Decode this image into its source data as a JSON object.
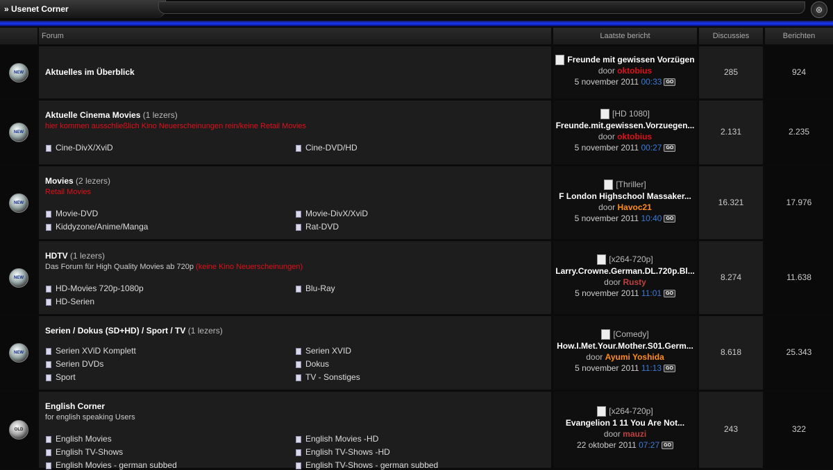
{
  "topbar": {
    "title": "» Usenet Corner",
    "collapse_symbol": "⊜"
  },
  "header": {
    "forum": "Forum",
    "last_post": "Laatste bericht",
    "discussions": "Discussies",
    "messages": "Berichten"
  },
  "colors": {
    "accent_blue": "#1438ff",
    "red": "#e0101a",
    "orange": "#ff8c1a",
    "brown": "#c04040",
    "time_blue": "#3b7bd8"
  },
  "forums": [
    {
      "badge": "NEW",
      "title": "Aktuelles im Überblick",
      "readers": "",
      "description": "",
      "description_extra": "",
      "subforums_left": [],
      "subforums_right": [],
      "last_post": {
        "prefix": "",
        "thread": "Freunde mit gewissen Vorzügen",
        "by": "door",
        "user": "oktobius",
        "user_color": "#e0101a",
        "date": "5 november 2011",
        "time": "00:33"
      },
      "discussions": "285",
      "messages": "924"
    },
    {
      "badge": "NEW",
      "title": "Aktuelle Cinema Movies",
      "readers": "(1 lezers)",
      "description": "hier kommen ausschließlich Kino Neuerscheinungen rein/keine Retail Movies",
      "description_red": true,
      "description_extra": "",
      "subforums_left": [
        "Cine-DivX/XviD"
      ],
      "subforums_right": [
        "Cine-DVD/HD"
      ],
      "last_post": {
        "prefix": "[HD 1080]",
        "thread": "Freunde.mit.gewissen.Vorzuegen...",
        "by": "door",
        "user": "oktobius",
        "user_color": "#e0101a",
        "date": "5 november 2011",
        "time": "00:27"
      },
      "discussions": "2.131",
      "messages": "2.235"
    },
    {
      "badge": "NEW",
      "title": "Movies",
      "readers": "(2 lezers)",
      "description": "Retail Movies",
      "description_red": true,
      "description_extra": "",
      "subforums_left": [
        "Movie-DVD",
        "Kiddyzone/Anime/Manga"
      ],
      "subforums_right": [
        "Movie-DivX/XviD",
        "Rat-DVD"
      ],
      "last_post": {
        "prefix": "[Thriller]",
        "thread": "F London Highschool Massaker...",
        "by": "door",
        "user": "Havoc21",
        "user_color": "#ff8c1a",
        "date": "5 november 2011",
        "time": "10:40"
      },
      "discussions": "16.321",
      "messages": "17.976"
    },
    {
      "badge": "NEW",
      "title": "HDTV",
      "readers": "(1 lezers)",
      "description": "Das Forum für High Quality Movies ab 720p",
      "description_red": false,
      "description_extra": "(keine Kino Neuerscheinungen)",
      "subforums_left": [
        "HD-Movies 720p-1080p",
        "HD-Serien"
      ],
      "subforums_right": [
        "Blu-Ray"
      ],
      "last_post": {
        "prefix": "[x264-720p]",
        "thread": "Larry.Crowne.German.DL.720p.Bl...",
        "by": "door",
        "user": "Rusty",
        "user_color": "#c04040",
        "date": "5 november 2011",
        "time": "11:01"
      },
      "discussions": "8.274",
      "messages": "11.638"
    },
    {
      "badge": "NEW",
      "title": "Serien / Dokus (SD+HD) / Sport / TV",
      "readers": "(1 lezers)",
      "description": "",
      "description_red": false,
      "description_extra": "",
      "subforums_left": [
        "Serien XViD Komplett",
        "Serien DVDs",
        "Sport"
      ],
      "subforums_right": [
        "Serien XVID",
        "Dokus",
        "TV - Sonstiges"
      ],
      "last_post": {
        "prefix": "[Comedy]",
        "thread": "How.I.Met.Your.Mother.S01.Germ...",
        "by": "door",
        "user": "Ayumi Yoshida",
        "user_color": "#ff8c1a",
        "date": "5 november 2011",
        "time": "11:13"
      },
      "discussions": "8.618",
      "messages": "25.343"
    },
    {
      "badge": "OLD",
      "title": "English Corner",
      "readers": "",
      "description": "for english speaking Users",
      "description_red": false,
      "description_extra": "",
      "subforums_left": [
        "English Movies",
        "English TV-Shows",
        "English Movies - german subbed"
      ],
      "subforums_right": [
        "English Movies -HD",
        "English TV-Shows -HD",
        "English TV-Shows - german subbed"
      ],
      "last_post": {
        "prefix": "[x264-720p]",
        "thread": "Evangelion 1 11 You Are Not...",
        "by": "door",
        "user": "mauzi",
        "user_color": "#c04040",
        "date": "22 oktober 2011",
        "time": "07:27"
      },
      "discussions": "243",
      "messages": "322"
    }
  ],
  "go_label": "GO"
}
